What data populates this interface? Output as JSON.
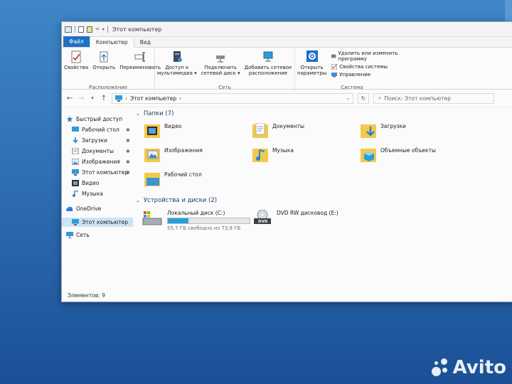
{
  "window": {
    "title": "Этот компьютер"
  },
  "ribbon_tabs": [
    "Файл",
    "Компьютер",
    "Вид"
  ],
  "ribbon": {
    "location_group": {
      "label": "Расположение",
      "buttons": [
        "Свойства",
        "Открыть",
        "Переименовать"
      ]
    },
    "network_group": {
      "label": "Сеть",
      "buttons": [
        {
          "l1": "Доступ к",
          "l2": "мультимедиа ▾"
        },
        {
          "l1": "Подключить",
          "l2": "сетевой диск ▾"
        },
        {
          "l1": "Добавить сетевое",
          "l2": "расположение"
        }
      ]
    },
    "system_group": {
      "label": "Система",
      "open_params": {
        "l1": "Открыть",
        "l2": "параметры"
      },
      "items": [
        "Удалить или изменить программу",
        "Свойства системы",
        "Управление"
      ]
    }
  },
  "address": {
    "path": "Этот компьютер",
    "search_placeholder": "Поиск: Этот компьютер"
  },
  "nav": [
    {
      "label": "Быстрый доступ",
      "pinned": false
    },
    {
      "label": "Рабочий стол",
      "pinned": true
    },
    {
      "label": "Загрузки",
      "pinned": true
    },
    {
      "label": "Документы",
      "pinned": true
    },
    {
      "label": "Изображения",
      "pinned": true
    },
    {
      "label": "Этот компьютер",
      "pinned": true
    },
    {
      "label": "Видео",
      "pinned": false
    },
    {
      "label": "Музыка",
      "pinned": false
    },
    {
      "label": "OneDrive",
      "pinned": false
    },
    {
      "label": "Этот компьютер",
      "pinned": false
    },
    {
      "label": "Сеть",
      "pinned": false
    }
  ],
  "pin_glyph": "✱",
  "sections": {
    "folders": "Папки (7)",
    "drives": "Устройства и диски (2)"
  },
  "folders": [
    "Видео",
    "Документы",
    "Загрузки",
    "Изображения",
    "Музыка",
    "Объемные объекты",
    "Рабочий стол"
  ],
  "drives": [
    {
      "name": "Локальный диск (C:)",
      "free": "55,7 ГБ свободно из 73,9 ГБ",
      "used_fraction": 0.25
    },
    {
      "name": "DVD RW дисковод (E:)",
      "badge": "DVD"
    }
  ],
  "status": "Элементов: 9",
  "watermark": "Avito",
  "colors": {
    "accent": "#1f6fc4",
    "selected": "#cce4f7",
    "folder": "#f2c94c",
    "drive_bar": "#26a0da"
  }
}
